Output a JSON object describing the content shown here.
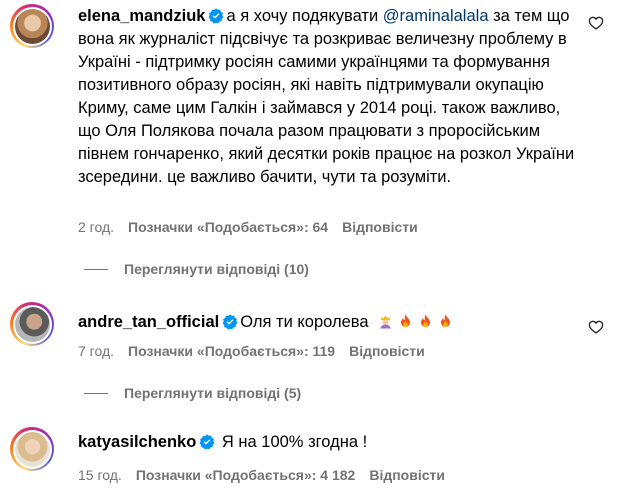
{
  "comments": [
    {
      "username": "elena_mandziuk",
      "text_before": "а я хочу подякувати ",
      "mention": "@raminalalala",
      "text_after": " за тем що вона як журналіст підсвічує та розкриває величезну проблему в Україні - підтримку росіян самими українцями та формування позитивного образу росіян, які навіть підтримували окупацію Криму, саме цим Галкін і займався у 2014 році. також важливо, що Оля Полякова почала разом працювати з проросійським півнем гончаренко, який десятки років працює на розкол України зсередини. це важливо бачити, чути та розуміти.",
      "time": "2 год.",
      "likes": "Позначки «Подобається»: 64",
      "reply": "Відповісти",
      "view_replies": "Переглянути відповіді (10)"
    },
    {
      "username": "andre_tan_official",
      "text": "Оля ти королева",
      "emojis": [
        "woman-with-crown-emoji",
        "fire-emoji",
        "fire-emoji",
        "fire-emoji"
      ],
      "time": "7 год.",
      "likes": "Позначки «Подобається»: 119",
      "reply": "Відповісти",
      "view_replies": "Переглянути відповіді (5)"
    },
    {
      "username": "katyasilchenko",
      "text": "Я на 100% згодна !",
      "time": "15 год.",
      "likes": "Позначки «Подобається»: 4 182",
      "reply": "Відповісти"
    }
  ],
  "colors": {
    "secondary_text": "#737373",
    "mention": "#00376b",
    "verified": "#0095f6"
  }
}
